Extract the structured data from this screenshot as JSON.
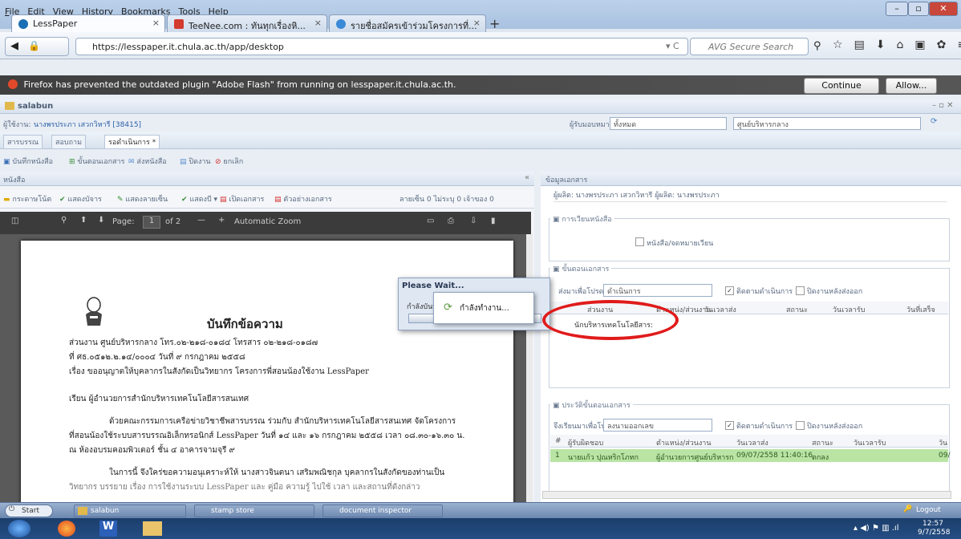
{
  "browser": {
    "menu": [
      "File",
      "Edit",
      "View",
      "History",
      "Bookmarks",
      "Tools",
      "Help"
    ],
    "tabs": [
      {
        "label": "LessPaper"
      },
      {
        "label": "TeeNee.com : ทันทุกเรื่องหิ..."
      },
      {
        "label": "รายชื่อสมัครเข้าร่วมโครงการที่..."
      }
    ],
    "url": "https://lesspaper.it.chula.ac.th/app/desktop",
    "search_placeholder": "AVG Secure Search",
    "flash_msg": "Firefox has prevented the outdated plugin \"Adobe Flash\" from running on lesspaper.it.chula.ac.th.",
    "continue_blocking": "Continue Blocking",
    "allow": "Allow..."
  },
  "app": {
    "window_title": "salabun",
    "user_label": "ผู้ใช้งาน:",
    "user_name": "นางพรประภา เสวกวิหารี [38415]",
    "assignee_label": "ผู้รับมอบหมาย:",
    "assignee_value": "ทั้งหมด",
    "center_value": "ศูนย์บริหารกลาง",
    "tabs": [
      "สารบรรณ",
      "สอบถาม",
      "รอดำเนินการ *"
    ],
    "toolbar": [
      "บันทึกหนังสือ",
      "ขั้นตอนเอกสาร",
      "ส่งหนังสือ",
      "ปิดงาน",
      "ยกเลิก"
    ],
    "left_title": "หนังสือ",
    "right_title": "ข้อมูลเอกสาร",
    "left_sub": [
      "กระดาษโน้ต",
      "แสดงบัจาร",
      "แสดงลายเซ็น",
      "แสดงบี",
      "เปิดเอกสาร",
      "ตัวอย่างเอกสาร"
    ],
    "left_sub_right": "ลายเซ็น 0 ไม่ระบุ 0 เจ้าของ 0"
  },
  "pdf": {
    "page_label": "Page:",
    "page_num": "1",
    "page_of": "of 2",
    "zoom": "Automatic Zoom"
  },
  "doc": {
    "heading": "บันทึกข้อความ",
    "line1": "ส่วนงาน ศูนย์บริหารกลาง          โทร.๐๒-๒๑๘-๐๑๘๔          โทรสาร ๐๒-๒๑๘-๐๑๘๗",
    "line2": "ที่ ศธ.๐๕๑๒.๒.๑๔/๐๐๐๔                    วันที่  ๙  กรกฎาคม  ๒๕๕๘",
    "line3": "เรื่อง  ขออนุญาตให้บุคลากรในสังกัดเป็นวิทยากร โครงการพี่สอนน้องใช้งาน LessPaper",
    "line4": "เรียน  ผู้อำนวยการสำนักบริหารเทคโนโลยีสารสนเทศ",
    "line5": "ด้วยคณะกรรมการเครือข่ายวิชาชีพสารบรรณ ร่วมกับ สำนักบริหารเทคโนโลยีสารสนเทศ จัดโครงการ",
    "line6": "ที่สอนน้องใช้ระบบสารบรรณอิเล็กทรอนิกส์ LessPaper วันที่ ๑๔ และ ๑๖ กรกฎาคม ๒๕๕๘ เวลา ๐๘.๓๐-๑๖.๓๐ น.",
    "line7": "ณ ห้องอบรมคอมพิวเตอร์ ชั้น ๔ อาคารจามจุรี ๙",
    "line8": "ในการนี้ จึงใคร่ขอความอนุเคราะห์ให้ นางสาวจินตนา  เสริมพณิชกุล บุคลากรในสังกัดของท่านเป็น",
    "line9": "วิทยากร บรรยาย เรื่อง การใช้งานระบบ LessPaper และ คู่มือ ความรู้ ไปใช้ เวลา และสถานที่ดังกล่าว"
  },
  "right": {
    "top_fields": "ผู้ผลิต:  นางพรประภา เสวกวิหารี          ผู้ผลิต:  นางพรประภา",
    "sec1": "การเวียนหนังสือ",
    "chk1": "หนังสือ/จดหมายเวียน",
    "sec2": "ขั้นตอนเอกสาร",
    "send_label": "ส่งมาเพื่อโปรด:",
    "send_value": "ดำเนินการ",
    "follow": "ติดตามดำเนินการ",
    "close_after": "ปิดงานหลังส่งออก",
    "cols2": [
      "ส่วนงาน",
      "ตำแหน่ง/ส่วนงาน",
      "วันเวลาส่ง",
      "สถานะ",
      "วันเวลารับ",
      "วันที่เสร็จ"
    ],
    "row2": "นักบริหารเทคโนโลยีสาร:",
    "sec3": "ประวัติขั้นตอนเอกสาร",
    "send3_label": "จึงเรียนมาเพื่อโปรด:",
    "send3_value": "ลงนามออกเลข",
    "cols3": [
      "#",
      "ผู้รับผิดชอบ",
      "ตำแหน่ง/ส่วนงาน",
      "วันเวลาส่ง",
      "สถานะ",
      "วันเวลารับ",
      "วันที่"
    ],
    "row3": [
      "1",
      "นายแก้ว ปุณหริกโภทก",
      "ผู้อำนวยการศูนย์บริหารก",
      "09/07/2558 11:40:16",
      "ตกลง",
      "",
      "09/"
    ]
  },
  "dialog": {
    "title": "Please Wait...",
    "label": "กำลังบันทึก",
    "busy": "กำลังทำงาน..."
  },
  "taskbar": {
    "start": "Start",
    "items": [
      "salabun",
      "stamp store",
      "document inspector"
    ],
    "logout": "Logout",
    "time": "12:57",
    "date": "9/7/2558"
  },
  "colors": {
    "highlight_circle": "#e01b1b",
    "row_selected": "#b9e4a4"
  }
}
